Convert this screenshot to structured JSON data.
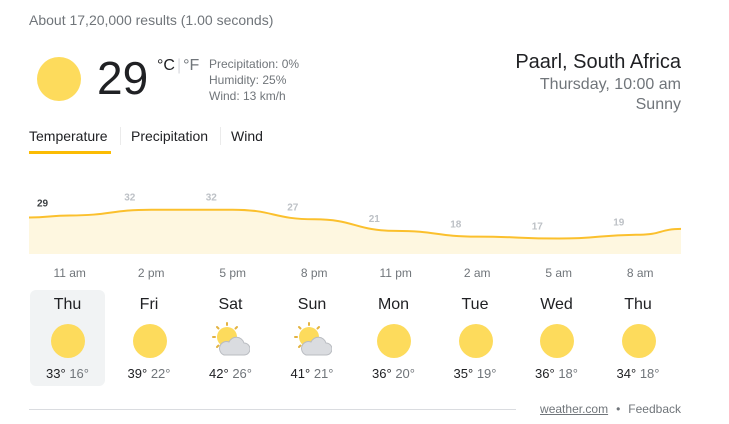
{
  "results_stats": "About 17,20,000 results (1.00 seconds)",
  "current": {
    "temperature": "29",
    "unit_c": "°C",
    "unit_f": "°F",
    "precipitation": "Precipitation: 0%",
    "humidity": "Humidity: 25%",
    "wind": "Wind: 13 km/h",
    "icon": "sun-icon"
  },
  "location": {
    "city": "Paarl, South Africa",
    "time": "Thursday, 10:00 am",
    "condition": "Sunny"
  },
  "tabs": [
    {
      "label": "Temperature",
      "active": true
    },
    {
      "label": "Precipitation",
      "active": false
    },
    {
      "label": "Wind",
      "active": false
    }
  ],
  "colors": {
    "accent": "#fbbc04",
    "sun": "#fddb5c",
    "chart_fill": "#fef7e0",
    "chart_line": "#fbc02d"
  },
  "chart_data": {
    "type": "area",
    "categories": [
      "11 am",
      "2 pm",
      "5 pm",
      "8 pm",
      "11 pm",
      "2 am",
      "5 am",
      "8 am"
    ],
    "series": [
      {
        "values": [
          29,
          32,
          32,
          27,
          21,
          18,
          17,
          19
        ]
      }
    ],
    "title": "",
    "xlabel": "",
    "ylabel": ""
  },
  "forecast": [
    {
      "day": "Thu",
      "high": "33°",
      "low": "16°",
      "icon": "sun-icon",
      "selected": true
    },
    {
      "day": "Fri",
      "high": "39°",
      "low": "22°",
      "icon": "sun-icon"
    },
    {
      "day": "Sat",
      "high": "42°",
      "low": "26°",
      "icon": "partly-cloudy-icon"
    },
    {
      "day": "Sun",
      "high": "41°",
      "low": "21°",
      "icon": "partly-cloudy-icon"
    },
    {
      "day": "Mon",
      "high": "36°",
      "low": "20°",
      "icon": "sun-icon"
    },
    {
      "day": "Tue",
      "high": "35°",
      "low": "19°",
      "icon": "sun-icon"
    },
    {
      "day": "Wed",
      "high": "36°",
      "low": "18°",
      "icon": "sun-icon"
    },
    {
      "day": "Thu",
      "high": "34°",
      "low": "18°",
      "icon": "sun-icon"
    }
  ],
  "footer": {
    "source": "weather.com",
    "separator": "•",
    "feedback": "Feedback"
  }
}
